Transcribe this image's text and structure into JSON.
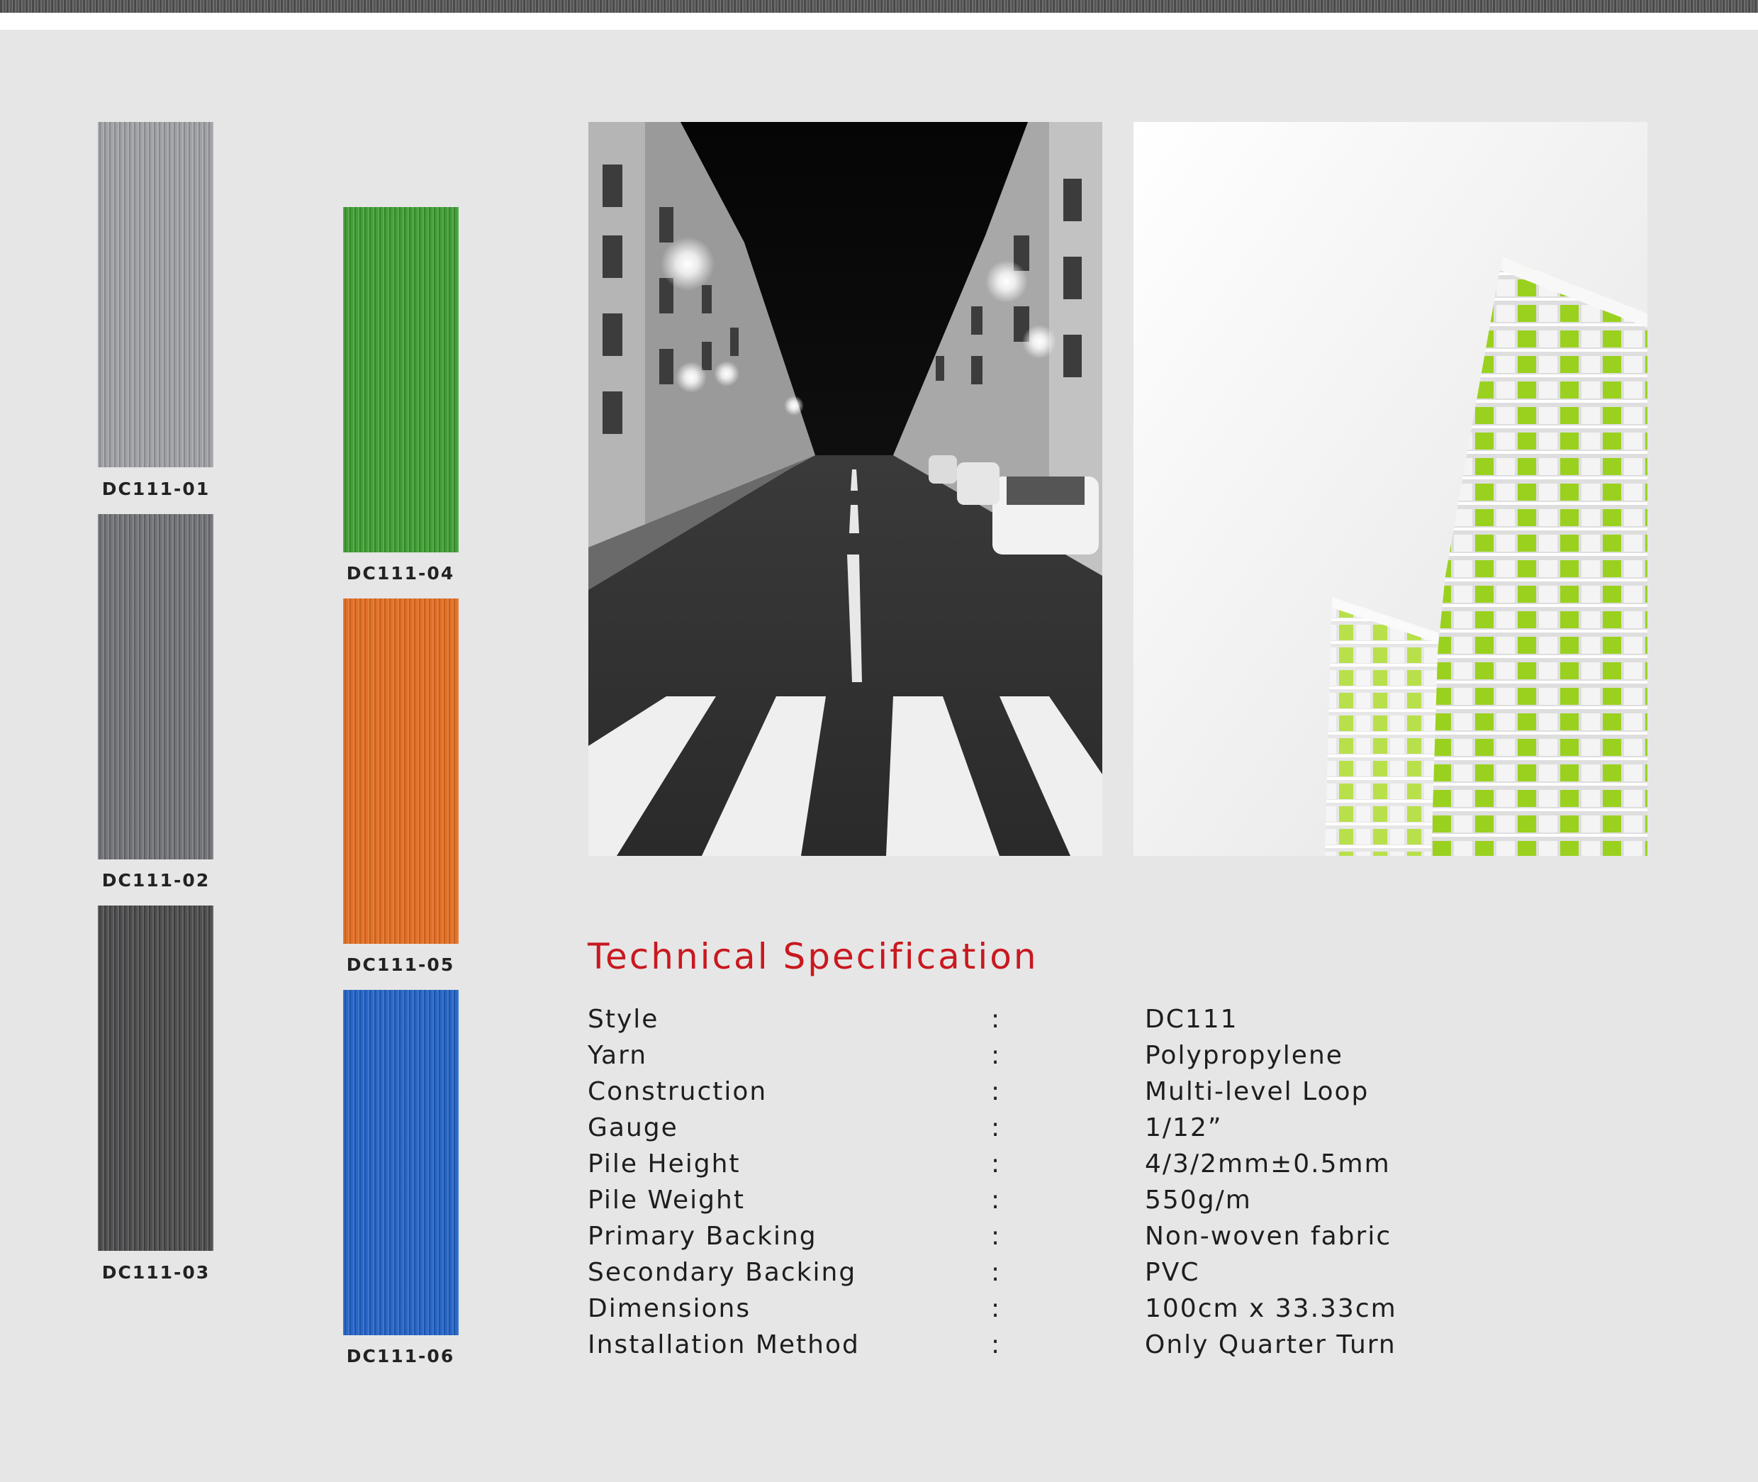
{
  "swatches": [
    {
      "label": "DC111-01",
      "color": "#9b9ca0"
    },
    {
      "label": "DC111-02",
      "color": "#6e6f73"
    },
    {
      "label": "DC111-03",
      "color": "#4a4a4c"
    },
    {
      "label": "DC111-04",
      "color": "#3a9a2e"
    },
    {
      "label": "DC111-05",
      "color": "#e06a1e"
    },
    {
      "label": "DC111-06",
      "color": "#1f5fc4"
    }
  ],
  "spec": {
    "title": "Technical Specification",
    "colon": ":",
    "rows": [
      {
        "label": "Style",
        "value": "DC111"
      },
      {
        "label": "Yarn",
        "value": "Polypropylene"
      },
      {
        "label": "Construction",
        "value": "Multi-level Loop"
      },
      {
        "label": "Gauge",
        "value": "1/12”"
      },
      {
        "label": "Pile Height",
        "value": "4/3/2mm±0.5mm"
      },
      {
        "label": "Pile Weight",
        "value": "550g/m"
      },
      {
        "label": "Primary Backing",
        "value": "Non-woven fabric"
      },
      {
        "label": "Secondary Backing",
        "value": "PVC"
      },
      {
        "label": "Dimensions",
        "value": "100cm x 33.33cm"
      },
      {
        "label": "Installation Method",
        "value": "Only Quarter Turn"
      }
    ]
  },
  "colors": {
    "background": "#e6e6e6",
    "title_red": "#c8191f",
    "building_green": "#9ad11e"
  }
}
